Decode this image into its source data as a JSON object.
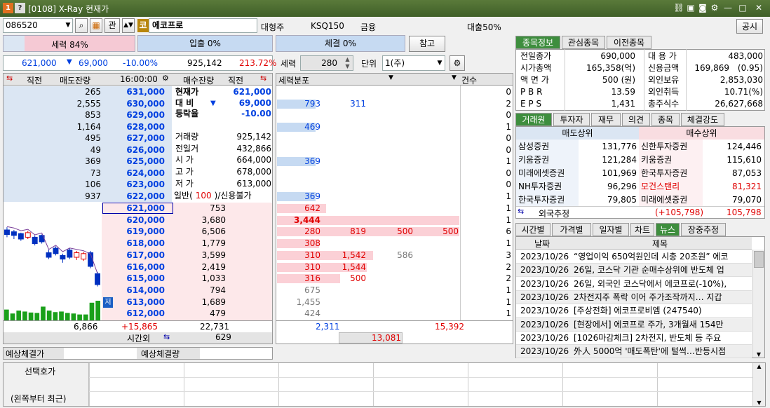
{
  "window": {
    "title": "[0108] X-Ray 현재가",
    "app_ico1": "1",
    "app_ico2": "?"
  },
  "toolbar": {
    "code": "086520",
    "gwan": "관",
    "stock_badge": "코",
    "stock_name": "에코프로",
    "category_label": "대형주",
    "index": "KSQ150",
    "sector": "금융",
    "loan": "대출50%",
    "notice_btn": "공시"
  },
  "bars": {
    "seryeok": "세력 84%",
    "ipchul": "입출 0%",
    "chegyeol": "체결 0%",
    "refer_btn": "참고",
    "seryeok_pct": 0.84
  },
  "price_line": {
    "price": "621,000",
    "arrow": "▼",
    "change": "69,000",
    "rate": "-10.00%",
    "volume": "925,142",
    "ratio": "213.72%"
  },
  "controls": {
    "seryeok_label": "세력",
    "seryeok_val": "280",
    "unit_label": "단위",
    "unit_val": "1(주)"
  },
  "ob_header": {
    "c1": "직전",
    "c2": "매도잔량",
    "time": "16:00:00",
    "c4": "매수잔량",
    "c5": "직전"
  },
  "asks": [
    {
      "qty": "265",
      "price": "631,000"
    },
    {
      "qty": "2,555",
      "price": "630,000"
    },
    {
      "qty": "853",
      "price": "629,000"
    },
    {
      "qty": "1,164",
      "price": "628,000"
    },
    {
      "qty": "495",
      "price": "627,000"
    },
    {
      "qty": "49",
      "price": "626,000"
    },
    {
      "qty": "369",
      "price": "625,000"
    },
    {
      "qty": "73",
      "price": "624,000"
    },
    {
      "qty": "106",
      "price": "623,000"
    },
    {
      "qty": "937",
      "price": "622,000"
    }
  ],
  "bids": [
    {
      "price": "621,000",
      "qty": "753"
    },
    {
      "price": "620,000",
      "qty": "3,680"
    },
    {
      "price": "619,000",
      "qty": "6,506"
    },
    {
      "price": "618,000",
      "qty": "1,779"
    },
    {
      "price": "617,000",
      "qty": "3,599"
    },
    {
      "price": "616,000",
      "qty": "2,419"
    },
    {
      "price": "615,000",
      "qty": "1,033"
    },
    {
      "price": "614,000",
      "qty": "794"
    },
    {
      "price": "613,000",
      "qty": "1,689"
    },
    {
      "price": "612,000",
      "qty": "479"
    }
  ],
  "info": [
    {
      "k": "현재가",
      "v": "621,000"
    },
    {
      "k": "대 비",
      "arrow": "▼",
      "v": "69,000"
    },
    {
      "k": "등락율",
      "v": "-10.00"
    },
    {
      "k": "거래량",
      "v": "925,142"
    },
    {
      "k": "전일거",
      "v": "432,866"
    },
    {
      "k": "시 가",
      "v": "664,000"
    },
    {
      "k": "고 가",
      "v": "678,000"
    },
    {
      "k": "저 가",
      "v": "613,000"
    }
  ],
  "info_misc": {
    "ilban": "일반(",
    "ilban_val": "100",
    "credit": ")/신용불가",
    "jeo": "저"
  },
  "ob_footer": {
    "ask_total": "6,866",
    "diff": "+15,865",
    "bid_total": "22,731",
    "after_label": "시간외",
    "after_val": "629"
  },
  "dist": {
    "header": "세력분포",
    "cnt_header": "건수",
    "rows": [
      {
        "a": "",
        "b": "",
        "c": "",
        "d": "",
        "n": "0"
      },
      {
        "a": "793",
        "b": "311",
        "c": "",
        "d": "",
        "n": "2"
      },
      {
        "a": "",
        "b": "",
        "c": "",
        "d": "",
        "n": "0"
      },
      {
        "a": "469",
        "b": "",
        "c": "",
        "d": "",
        "n": "1"
      },
      {
        "a": "",
        "b": "",
        "c": "",
        "d": "",
        "n": "0"
      },
      {
        "a": "",
        "b": "",
        "c": "",
        "d": "",
        "n": "0"
      },
      {
        "a": "369",
        "b": "",
        "c": "",
        "d": "",
        "n": "1"
      },
      {
        "a": "",
        "b": "",
        "c": "",
        "d": "",
        "n": "0"
      },
      {
        "a": "",
        "b": "",
        "c": "",
        "d": "",
        "n": "0"
      },
      {
        "a": "369",
        "b": "",
        "c": "",
        "d": "",
        "n": "1"
      },
      {
        "a": "642",
        "b": "",
        "c": "",
        "d": "",
        "n": "1"
      },
      {
        "a": "3,444",
        "b": "",
        "c": "",
        "d": "",
        "n": "1"
      },
      {
        "a": "280",
        "b": "819",
        "c": "500",
        "d": "500",
        "n": "6"
      },
      {
        "a": "308",
        "b": "",
        "c": "",
        "d": "",
        "n": "1"
      },
      {
        "a": "310",
        "b": "1,542",
        "c": "586",
        "d": "",
        "n": "3"
      },
      {
        "a": "310",
        "b": "1,544",
        "c": "",
        "d": "",
        "n": "2"
      },
      {
        "a": "316",
        "b": "500",
        "c": "",
        "d": "",
        "n": "2"
      },
      {
        "a": "675",
        "b": "",
        "c": "",
        "d": "",
        "n": "1"
      },
      {
        "a": "1,455",
        "b": "",
        "c": "",
        "d": "",
        "n": "1"
      },
      {
        "a": "424",
        "b": "",
        "c": "",
        "d": "",
        "n": "1"
      }
    ],
    "foot_left": "2,311",
    "foot_right": "15,392",
    "foot_mid": "13,081"
  },
  "bottom": {
    "exp_price": "예상체결가",
    "exp_qty": "예상체결량",
    "sel_label": "선택호가",
    "recent_label": "(왼쪽부터 최근)"
  },
  "right_tabs": [
    "종목정보",
    "관심종목",
    "이전종목"
  ],
  "stockinfo": [
    {
      "k1": "전일종가",
      "v1": "690,000",
      "k2": "대 용 가",
      "v2": "483,000"
    },
    {
      "k1": "시가총액",
      "v1": "165,358(억)",
      "k2": "신용금액",
      "v2": "169,869",
      "v2b": "(0.95)"
    },
    {
      "k1": "액 면 가",
      "v1": "500 (원)",
      "k2": "외인보유",
      "v2": "2,853,030"
    },
    {
      "k1": "P B R",
      "v1": "13.59",
      "k2": "외인취득",
      "v2": "10.71(%)"
    },
    {
      "k1": "E P S",
      "v1": "1,431",
      "k2": "총주식수",
      "v2": "26,627,668"
    }
  ],
  "mid_tabs": [
    "거래원",
    "투자자",
    "재무",
    "의견",
    "종목",
    "체결강도"
  ],
  "broker_head": {
    "sell": "매도상위",
    "buy": "매수상위"
  },
  "brokers": [
    {
      "s": "삼성증권",
      "sv": "131,776",
      "b": "신한투자증권",
      "bv": "124,446"
    },
    {
      "s": "키움증권",
      "sv": "121,284",
      "b": "키움증권",
      "bv": "115,610"
    },
    {
      "s": "미래에셋증권",
      "sv": "101,969",
      "b": "한국투자증권",
      "bv": "87,053"
    },
    {
      "s": "NH투자증권",
      "sv": "96,296",
      "b": "모건스탠리",
      "bv": "81,321"
    },
    {
      "s": "한국투자증권",
      "sv": "79,805",
      "b": "미래에셋증권",
      "bv": "79,070"
    }
  ],
  "foreign": {
    "label": "외국추정",
    "diff": "(+105,798)",
    "val": "105,798"
  },
  "news_tabs": [
    "시간별",
    "가격별",
    "일자별",
    "차트",
    "뉴스",
    "장중추정"
  ],
  "news_head": {
    "date": "날짜",
    "title": "제목"
  },
  "news": [
    {
      "d": "2023/10/26",
      "t": "“영업이익 650억원인데 시총 20조원” 에코"
    },
    {
      "d": "2023/10/26",
      "t": "26일, 코스닥 기관 순매수상위에 반도체 업"
    },
    {
      "d": "2023/10/26",
      "t": "26일, 외국인 코스닥에서 에코프로(-10%),"
    },
    {
      "d": "2023/10/26",
      "t": "2차전지주 폭락 이어 주가조작까지… 지갑"
    },
    {
      "d": "2023/10/26",
      "t": "[주상전화] 에코프로비엠 (247540)"
    },
    {
      "d": "2023/10/26",
      "t": "[현장에서] 에코프로 주가, 3개월새 154만"
    },
    {
      "d": "2023/10/26",
      "t": "[1026마감체크] 2차전지, 반도체 등 주요"
    },
    {
      "d": "2023/10/26",
      "t": "外人 5000억 '매도폭탄'에 털썩…반등시점"
    }
  ],
  "mini_chart": {
    "badge": "저",
    "bars": [
      0.55,
      0.35,
      0.5,
      0.45,
      0.4,
      0.38,
      0.7,
      0.5,
      0.42,
      0.45,
      0.38,
      0.35,
      0.3,
      0.3,
      0.9,
      1.0
    ],
    "candles": [
      {
        "o": 0.3,
        "c": 0.35,
        "h": 0.38,
        "l": 0.27,
        "up": false
      },
      {
        "o": 0.36,
        "c": 0.32,
        "h": 0.4,
        "l": 0.3,
        "up": false
      },
      {
        "o": 0.4,
        "c": 0.34,
        "h": 0.42,
        "l": 0.33,
        "up": false
      },
      {
        "o": 0.33,
        "c": 0.38,
        "h": 0.4,
        "l": 0.31,
        "up": true
      },
      {
        "o": 0.45,
        "c": 0.38,
        "h": 0.47,
        "l": 0.36,
        "up": false
      },
      {
        "o": 0.43,
        "c": 0.36,
        "h": 0.45,
        "l": 0.35,
        "up": false
      },
      {
        "o": 0.6,
        "c": 0.55,
        "h": 0.62,
        "l": 0.52,
        "up": false
      },
      {
        "o": 0.56,
        "c": 0.5,
        "h": 0.58,
        "l": 0.48,
        "up": false
      },
      {
        "o": 0.62,
        "c": 0.58,
        "h": 0.66,
        "l": 0.56,
        "up": false
      },
      {
        "o": 0.6,
        "c": 0.52,
        "h": 0.62,
        "l": 0.5,
        "up": false
      },
      {
        "o": 0.55,
        "c": 0.6,
        "h": 0.63,
        "l": 0.53,
        "up": true
      },
      {
        "o": 0.56,
        "c": 0.62,
        "h": 0.64,
        "l": 0.54,
        "up": true
      },
      {
        "o": 0.55,
        "c": 0.7,
        "h": 0.72,
        "l": 0.53,
        "up": false
      },
      {
        "o": 0.78,
        "c": 0.9,
        "h": 0.92,
        "l": 0.76,
        "up": false
      }
    ]
  }
}
